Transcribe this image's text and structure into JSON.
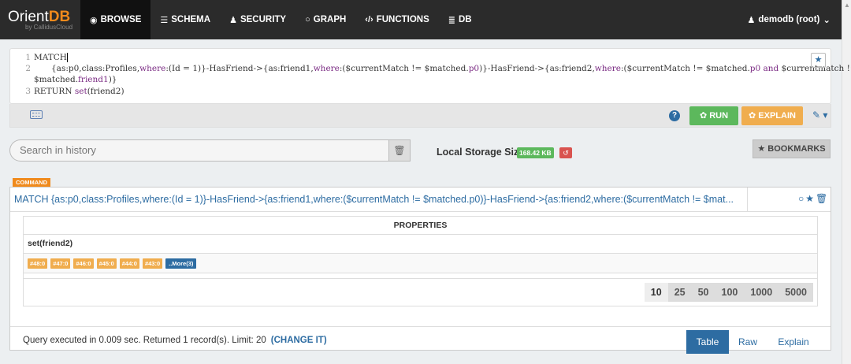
{
  "navbar": {
    "logo_text_1": "Orient",
    "logo_text_2": "DB",
    "logo_sub": "by CallidusCloud",
    "items": [
      {
        "label": "BROWSE",
        "icon": "eye-icon"
      },
      {
        "label": "SCHEMA",
        "icon": "list-icon"
      },
      {
        "label": "SECURITY",
        "icon": "user-icon"
      },
      {
        "label": "GRAPH",
        "icon": "circle-icon"
      },
      {
        "label": "FUNCTIONS",
        "icon": "code-icon"
      },
      {
        "label": "DB",
        "icon": "database-icon"
      }
    ],
    "user": "demodb (root)"
  },
  "editor": {
    "line1_kw": "MATCH",
    "line2_a": "{as:p0,class:Profiles,",
    "line2_b": "where",
    "line2_c": ":(Id = 1)}-HasFriend->{as:friend1,",
    "line2_d": "where",
    "line2_e": ":($currentMatch != $matched.",
    "line2_f": "p0",
    "line2_g": ")}-HasFriend->{as:friend2,",
    "line2_h": "where",
    "line2_i": ":($currentMatch != $matched.",
    "line2_j": "p0",
    "line2_k": " and",
    "line2_l": " $currentmatch !=",
    "line2b_a": "$matched.",
    "line2b_b": "friend1",
    "line2b_c": ")}",
    "line3_kw": "RETURN",
    "line3_fn": " set",
    "line3_rest": "(friend2)"
  },
  "toolbar": {
    "help": "?",
    "run_label": "RUN",
    "explain_label": "EXPLAIN"
  },
  "history": {
    "search_placeholder": "Search in history",
    "storage_label": "Local Storage Size",
    "storage_value": "168.42 KB",
    "bookmarks_label": "BOOKMARKS"
  },
  "result": {
    "command_tag": "COMMAND",
    "query": "MATCH {as:p0,class:Profiles,where:(Id = 1)}-HasFriend->{as:friend1,where:($currentMatch != $matched.p0)}-HasFriend->{as:friend2,where:($currentMatch != $mat...",
    "properties_header": "PROPERTIES",
    "column": "set(friend2)",
    "rids": [
      "#48:0",
      "#47:0",
      "#46:0",
      "#45:0",
      "#44:0",
      "#43:0"
    ],
    "more_label": "..More(3)",
    "page_sizes": [
      "10",
      "25",
      "50",
      "100",
      "1000",
      "5000"
    ],
    "status": "Query executed in 0.009 sec. Returned 1 record(s). Limit: 20",
    "change_link": "(CHANGE IT)",
    "view_tabs": [
      "Table",
      "Raw",
      "Explain"
    ]
  }
}
